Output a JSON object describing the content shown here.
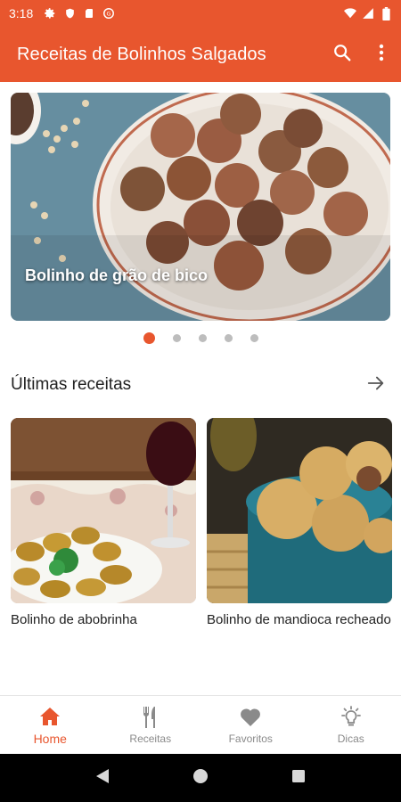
{
  "status_bar": {
    "time": "3:18",
    "left_icons": [
      "gear-icon",
      "shield-icon",
      "sd-card-icon",
      "sync-icon"
    ],
    "right_icons": [
      "wifi-icon",
      "signal-icon",
      "battery-icon"
    ]
  },
  "app_bar": {
    "title": "Receitas de Bolinhos Salgados",
    "actions": [
      "search-icon",
      "more-vert-icon"
    ]
  },
  "carousel": {
    "caption": "Bolinho de grão de bico",
    "page_count": 5,
    "active_index": 0
  },
  "latest": {
    "title": "Últimas receitas",
    "cards": [
      {
        "title": "Bolinho de abobrinha"
      },
      {
        "title": "Bolinho de mandioca recheado"
      }
    ]
  },
  "bottom_nav": {
    "items": [
      {
        "label": "Home",
        "icon": "home-icon",
        "active": true
      },
      {
        "label": "Receitas",
        "icon": "utensils-icon",
        "active": false
      },
      {
        "label": "Favoritos",
        "icon": "heart-icon",
        "active": false
      },
      {
        "label": "Dicas",
        "icon": "lightbulb-icon",
        "active": false
      }
    ]
  },
  "colors": {
    "primary": "#e8562e",
    "inactive": "#8a8a8a",
    "text": "#212121"
  }
}
